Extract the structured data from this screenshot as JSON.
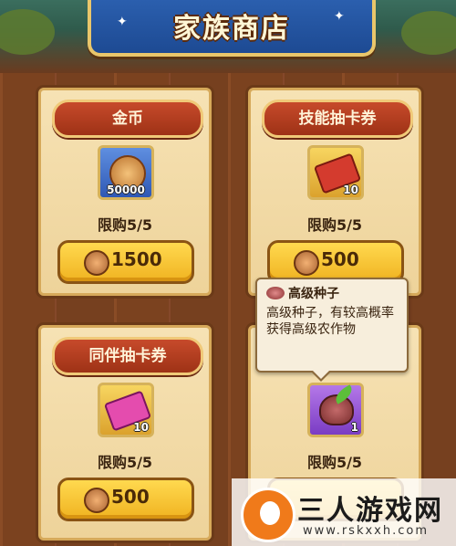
{
  "header": {
    "title": "家族商店"
  },
  "items": [
    {
      "name": "金币",
      "count": "50000",
      "limit": "限购5/5",
      "price": "1500",
      "icon": "gold-coin-icon"
    },
    {
      "name": "技能抽卡券",
      "count": "10",
      "limit": "限购5/5",
      "price": "500",
      "icon": "skill-ticket-icon"
    },
    {
      "name": "同伴抽卡券",
      "count": "10",
      "limit": "限购5/5",
      "price": "500",
      "icon": "companion-ticket-icon"
    },
    {
      "name": "",
      "count": "1",
      "limit": "限购5/5",
      "price": "",
      "icon": "seed-icon"
    }
  ],
  "tooltip": {
    "title": "高级种子",
    "description": "高级种子，有较高概率获得高级农作物"
  },
  "watermark": {
    "title": "三人游戏网",
    "url": "www.rskxxh.com"
  },
  "colors": {
    "banner": "#1d4a93",
    "card": "#f6e2b4",
    "header_red": "#c74a2b",
    "button_gold": "#ffd94f"
  }
}
